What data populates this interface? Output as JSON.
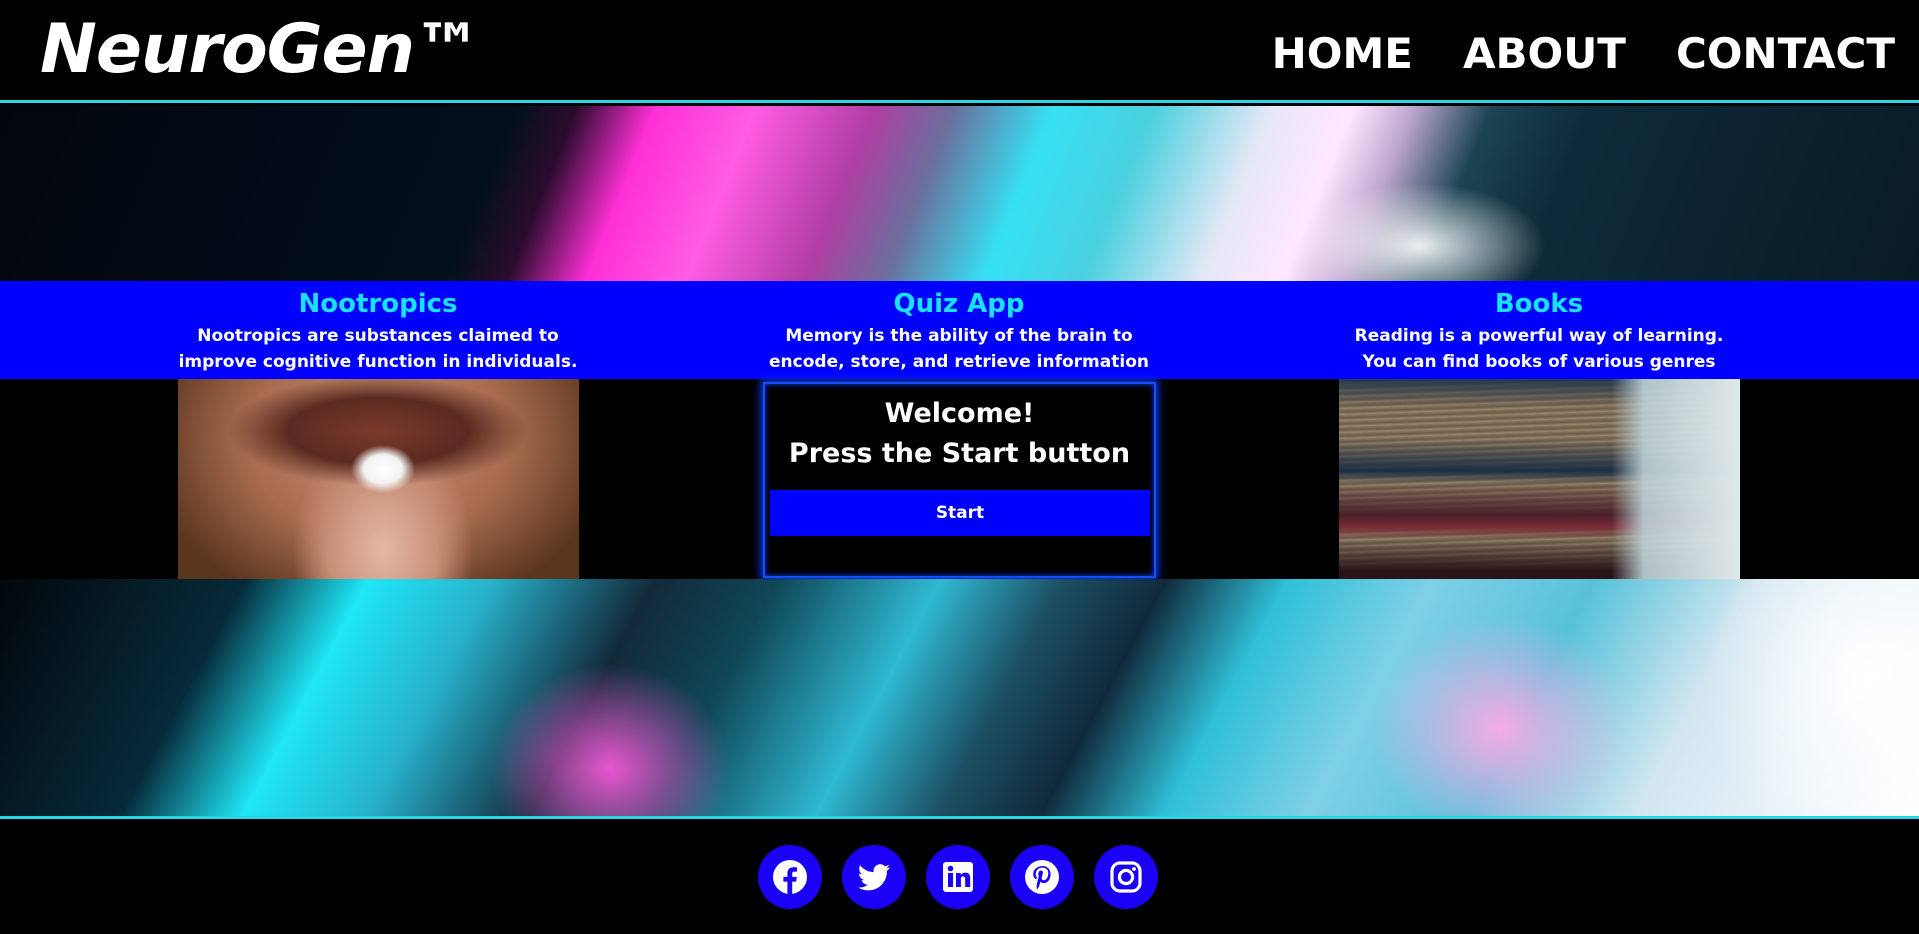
{
  "brand": "NeuroGen™",
  "nav": {
    "home": "HOME",
    "about": "ABOUT",
    "contact": "CONTACT"
  },
  "features": [
    {
      "title": "Nootropics",
      "description": "Nootropics are substances claimed to improve cognitive function in individuals."
    },
    {
      "title": "Quiz App",
      "description": "Memory is the ability of the brain to encode, store, and retrieve information over time."
    },
    {
      "title": "Books",
      "description": "Reading is a powerful way of learning. You can find books of various genres below."
    }
  ],
  "quiz": {
    "welcome": "Welcome!",
    "instruction": "Press the Start button",
    "start_label": "Start"
  },
  "social": [
    "facebook-icon",
    "twitter-icon",
    "linkedin-icon",
    "pinterest-icon",
    "instagram-icon"
  ],
  "colors": {
    "accent_cyan": "#18e0ff",
    "feature_bar": "#0000ff",
    "social_button": "#1a00f5",
    "divider": "#2ad7e6"
  }
}
